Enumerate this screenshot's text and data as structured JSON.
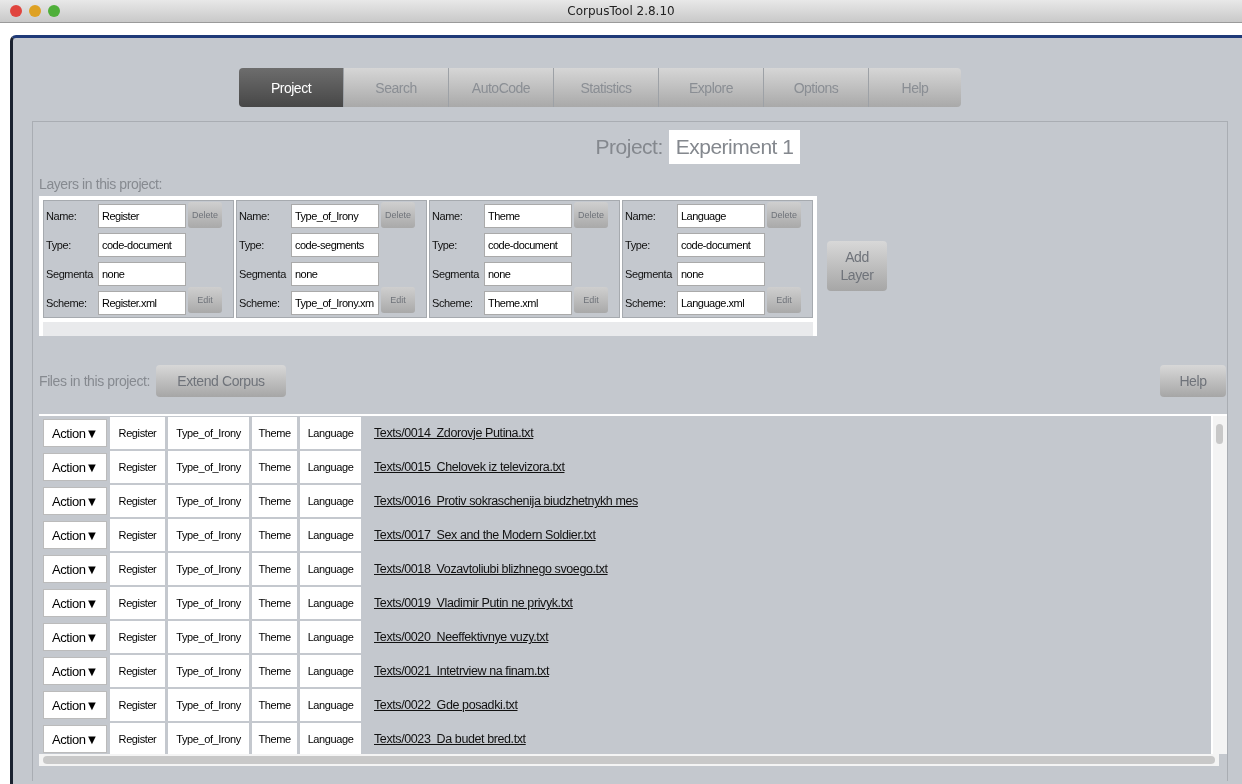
{
  "window": {
    "title": "CorpusTool 2.8.10"
  },
  "tabs": [
    {
      "label": "Project",
      "selected": true
    },
    {
      "label": "Search",
      "selected": false
    },
    {
      "label": "AutoCode",
      "selected": false
    },
    {
      "label": "Statistics",
      "selected": false
    },
    {
      "label": "Explore",
      "selected": false
    },
    {
      "label": "Options",
      "selected": false
    },
    {
      "label": "Help",
      "selected": false
    }
  ],
  "project": {
    "label": "Project:",
    "name": "Experiment 1"
  },
  "layers_label": "Layers in this project:",
  "layers": [
    {
      "fields": [
        {
          "label": "Name:",
          "value": "Register"
        },
        {
          "label": "Type:",
          "value": "code-document"
        },
        {
          "label": "Segmenta",
          "value": "none"
        },
        {
          "label": "Scheme:",
          "value": "Register.xml"
        }
      ],
      "delete": {
        "label": "Delete",
        "disabled": true
      },
      "edit": {
        "label": "Edit",
        "disabled": true
      }
    },
    {
      "fields": [
        {
          "label": "Name:",
          "value": "Type_of_Irony"
        },
        {
          "label": "Type:",
          "value": "code-segments"
        },
        {
          "label": "Segmenta",
          "value": "none"
        },
        {
          "label": "Scheme:",
          "value": "Type_of_Irony.xm"
        }
      ],
      "delete": {
        "label": "Delete",
        "disabled": true
      },
      "edit": {
        "label": "Edit",
        "disabled": true
      }
    },
    {
      "fields": [
        {
          "label": "Name:",
          "value": "Theme"
        },
        {
          "label": "Type:",
          "value": "code-document"
        },
        {
          "label": "Segmenta",
          "value": "none"
        },
        {
          "label": "Scheme:",
          "value": "Theme.xml"
        }
      ],
      "delete": {
        "label": "Delete",
        "disabled": true
      },
      "edit": {
        "label": "Edit",
        "disabled": true
      }
    },
    {
      "fields": [
        {
          "label": "Name:",
          "value": "Language"
        },
        {
          "label": "Type:",
          "value": "code-document"
        },
        {
          "label": "Segmenta",
          "value": "none"
        },
        {
          "label": "Scheme:",
          "value": "Language.xml"
        }
      ],
      "delete": {
        "label": "Delete",
        "disabled": true
      },
      "edit": {
        "label": "Edit",
        "disabled": true
      }
    }
  ],
  "add_layer": {
    "label": "Add Layer",
    "disabled": true
  },
  "files_label": "Files in this project:",
  "extend_corpus": {
    "label": "Extend Corpus",
    "disabled": true
  },
  "help_button": {
    "label": "Help",
    "disabled": true
  },
  "files": [
    {
      "action": "Action▼",
      "layers": [
        "Register",
        "Type_of_Irony",
        "Theme",
        "Language"
      ],
      "path": "Texts/0014  Zdorovje Putina.txt"
    },
    {
      "action": "Action▼",
      "layers": [
        "Register",
        "Type_of_Irony",
        "Theme",
        "Language"
      ],
      "path": "Texts/0015  Chelovek iz televizora.txt"
    },
    {
      "action": "Action▼",
      "layers": [
        "Register",
        "Type_of_Irony",
        "Theme",
        "Language"
      ],
      "path": "Texts/0016  Protiv sokraschenija biudzhetnykh mes"
    },
    {
      "action": "Action▼",
      "layers": [
        "Register",
        "Type_of_Irony",
        "Theme",
        "Language"
      ],
      "path": "Texts/0017  Sex and the Modern Soldier.txt"
    },
    {
      "action": "Action▼",
      "layers": [
        "Register",
        "Type_of_Irony",
        "Theme",
        "Language"
      ],
      "path": "Texts/0018  Vozavtoliubi blizhnego svoego.txt"
    },
    {
      "action": "Action▼",
      "layers": [
        "Register",
        "Type_of_Irony",
        "Theme",
        "Language"
      ],
      "path": "Texts/0019  Vladimir Putin ne privyk.txt"
    },
    {
      "action": "Action▼",
      "layers": [
        "Register",
        "Type_of_Irony",
        "Theme",
        "Language"
      ],
      "path": "Texts/0020  Neeffektivnye vuzy.txt"
    },
    {
      "action": "Action▼",
      "layers": [
        "Register",
        "Type_of_Irony",
        "Theme",
        "Language"
      ],
      "path": "Texts/0021  Intetrview na finam.txt"
    },
    {
      "action": "Action▼",
      "layers": [
        "Register",
        "Type_of_Irony",
        "Theme",
        "Language"
      ],
      "path": "Texts/0022  Gde posadki.txt"
    },
    {
      "action": "Action▼",
      "layers": [
        "Register",
        "Type_of_Irony",
        "Theme",
        "Language"
      ],
      "path": "Texts/0023  Da budet bred.txt"
    }
  ]
}
